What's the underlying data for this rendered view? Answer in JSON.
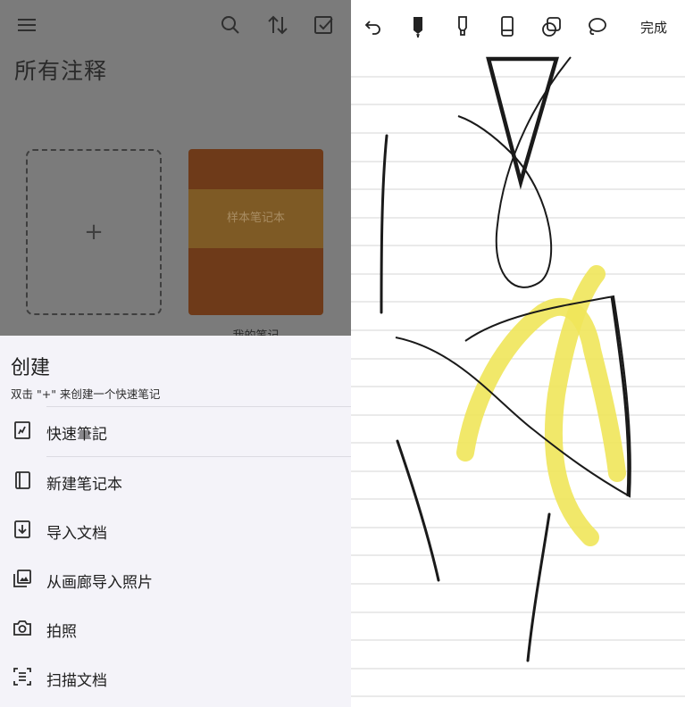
{
  "library": {
    "title": "所有注释",
    "add_tile_symbol": "+",
    "notebook": {
      "cover_text": "样本笔记本",
      "caption": "我的笔记"
    },
    "icons": [
      "menu-icon",
      "search-icon",
      "sort-icon",
      "select-icon"
    ]
  },
  "create_sheet": {
    "title": "创建",
    "hint": "双击 \"+\" 来创建一个快速笔记",
    "items": [
      {
        "label": "快速筆記",
        "icon": "quick-note-icon"
      },
      {
        "label": "新建笔记本",
        "icon": "notebook-icon"
      },
      {
        "label": "导入文档",
        "icon": "import-document-icon"
      },
      {
        "label": "从画廊导入照片",
        "icon": "gallery-icon"
      },
      {
        "label": "拍照",
        "icon": "camera-icon"
      },
      {
        "label": "扫描文档",
        "icon": "scan-icon"
      }
    ]
  },
  "editor": {
    "done_label": "完成",
    "tools": [
      "undo-icon",
      "pen-icon",
      "highlighter-icon",
      "eraser-icon",
      "shapes-icon",
      "lasso-icon"
    ]
  },
  "colors": {
    "overlay": "#7b7b7b",
    "sheet_bg": "#f4f3f9",
    "notebook_cover": "#6e3a19",
    "notebook_band": "#7e5a25",
    "ink": "#1a1a1a",
    "highlight": "#f0e55a",
    "ruled_line": "#d4d4d4"
  }
}
